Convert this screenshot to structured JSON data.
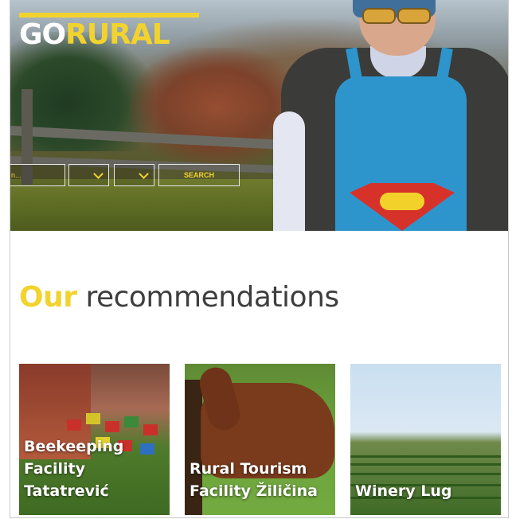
{
  "brand": {
    "go": "GO",
    "rural": "RURAL"
  },
  "search": {
    "text_value": "n...",
    "button_label": "SEARCH"
  },
  "section": {
    "highlight": "Our",
    "rest": "recommendations"
  },
  "cards": [
    {
      "title": "Beekeeping\nFacility\nTatatrević"
    },
    {
      "title": "Rural Tourism\nFacility Žiličina"
    },
    {
      "title": "Winery Lug"
    }
  ],
  "colors": {
    "accent": "#f2d32e",
    "heading": "#3e3e3e"
  }
}
